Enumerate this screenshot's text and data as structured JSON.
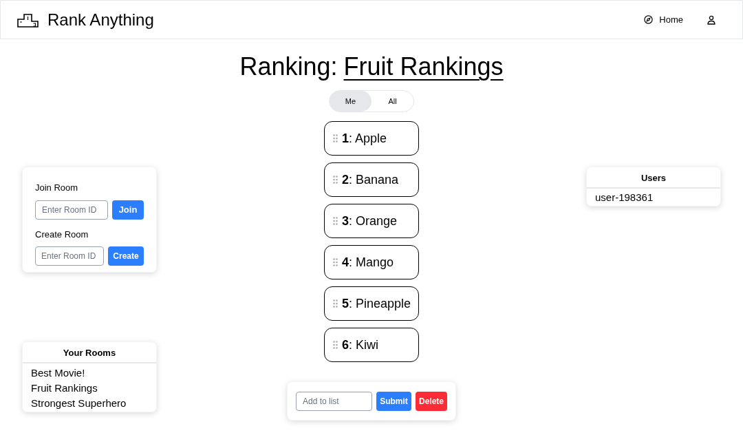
{
  "header": {
    "app_name": "Rank Anything",
    "nav": [
      {
        "label": "Home"
      }
    ]
  },
  "ranking": {
    "prefix": "Ranking:",
    "title": "Fruit Rankings"
  },
  "view_toggle": [
    {
      "label": "Me",
      "selected": true
    },
    {
      "label": "All",
      "selected": false
    }
  ],
  "items": [
    {
      "text": "**1**: Apple"
    },
    {
      "text": "**2**: Banana"
    },
    {
      "text": "**3**: Orange"
    },
    {
      "text": "**4**: Mango"
    },
    {
      "text": "**5**: Pineapple"
    },
    {
      "text": "**6**: Kiwi"
    }
  ],
  "add_form": {
    "placeholder": "Add to list",
    "buttons": [
      {
        "label": "Submit",
        "kind": "primary"
      },
      {
        "label": "Delete",
        "kind": "danger"
      }
    ]
  },
  "room_card": {
    "join_label": "Join Room",
    "join_placeholder": "Enter Room ID",
    "join_button": "Join",
    "create_label": "Create Room",
    "create_placeholder": "Enter Room ID",
    "create_button": "Create"
  },
  "your_rooms": {
    "title": "Your Rooms",
    "rooms": [
      "Best Movie!",
      "Fruit Rankings",
      "Strongest Superhero"
    ]
  },
  "users": {
    "title": "Users",
    "list": [
      "user-198361"
    ]
  }
}
